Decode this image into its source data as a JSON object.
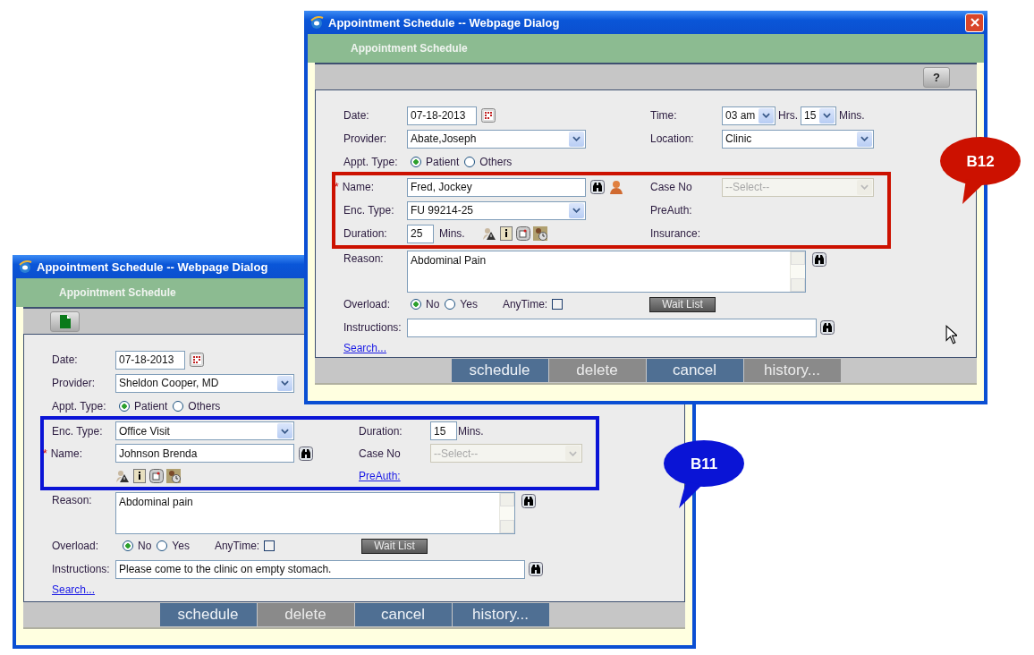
{
  "back_dialog": {
    "title": "Appointment Schedule -- Webpage Dialog",
    "header": "Appointment Schedule",
    "date": {
      "label": "Date:",
      "value": "07-18-2013"
    },
    "provider": {
      "label": "Provider:",
      "value": "Sheldon Cooper, MD"
    },
    "appt_type": {
      "label": "Appt. Type:",
      "options": [
        {
          "label": "Patient",
          "selected": true
        },
        {
          "label": "Others",
          "selected": false
        }
      ]
    },
    "enc_type": {
      "label": "Enc. Type:",
      "value": "Office Visit"
    },
    "duration": {
      "label": "Duration:",
      "value": "15",
      "unit": "Mins."
    },
    "name": {
      "marker": "*",
      "label": "Name:",
      "value": "Johnson Brenda"
    },
    "case_no": {
      "label": "Case No",
      "placeholder": "--Select--",
      "disabled": true
    },
    "preauth": {
      "label": "PreAuth:",
      "link": true
    },
    "reason": {
      "label": "Reason:",
      "value": "Abdominal pain"
    },
    "overload": {
      "label": "Overload:",
      "options": [
        {
          "label": "No",
          "selected": true
        },
        {
          "label": "Yes",
          "selected": false
        }
      ]
    },
    "anytime": {
      "label": "AnyTime:",
      "checked": false
    },
    "wait_list": "Wait List",
    "instructions": {
      "label": "Instructions:",
      "value": "Please come to the clinic on empty stomach."
    },
    "search_link": "Search...",
    "buttons": [
      {
        "label": "schedule",
        "disabled": false
      },
      {
        "label": "delete",
        "disabled": true
      },
      {
        "label": "cancel",
        "disabled": false
      },
      {
        "label": "history...",
        "disabled": false
      }
    ]
  },
  "front_dialog": {
    "title": "Appointment Schedule -- Webpage Dialog",
    "header": "Appointment Schedule",
    "help_button": "?",
    "date": {
      "label": "Date:",
      "value": "07-18-2013"
    },
    "time": {
      "label": "Time:",
      "hours": "03 am",
      "hours_unit": "Hrs.",
      "minutes": "15",
      "minutes_unit": "Mins."
    },
    "provider": {
      "label": "Provider:",
      "value": "Abate,Joseph"
    },
    "location": {
      "label": "Location:",
      "value": "Clinic"
    },
    "appt_type": {
      "label": "Appt. Type:",
      "options": [
        {
          "label": "Patient",
          "selected": true
        },
        {
          "label": "Others",
          "selected": false
        }
      ]
    },
    "name": {
      "marker": "*",
      "label": "Name:",
      "value": "Fred, Jockey"
    },
    "case_no": {
      "label": "Case No",
      "placeholder": "--Select--",
      "disabled": true
    },
    "enc_type": {
      "label": "Enc. Type:",
      "value": "FU 99214-25"
    },
    "preauth": {
      "label": "PreAuth:",
      "link": false
    },
    "duration": {
      "label": "Duration:",
      "value": "25",
      "unit": "Mins."
    },
    "insurance": {
      "label": "Insurance:"
    },
    "reason": {
      "label": "Reason:",
      "value": "Abdominal Pain"
    },
    "overload": {
      "label": "Overload:",
      "options": [
        {
          "label": "No",
          "selected": true
        },
        {
          "label": "Yes",
          "selected": false
        }
      ]
    },
    "anytime": {
      "label": "AnyTime:",
      "checked": false
    },
    "wait_list": "Wait List",
    "instructions": {
      "label": "Instructions:"
    },
    "search_link": "Search...",
    "buttons": [
      {
        "label": "schedule",
        "disabled": false
      },
      {
        "label": "delete",
        "disabled": true
      },
      {
        "label": "cancel",
        "disabled": false
      },
      {
        "label": "history...",
        "disabled": true
      }
    ]
  },
  "callouts": [
    {
      "label": "B12",
      "color": "#cc1100"
    },
    {
      "label": "B11",
      "color": "#0a14d6"
    }
  ]
}
